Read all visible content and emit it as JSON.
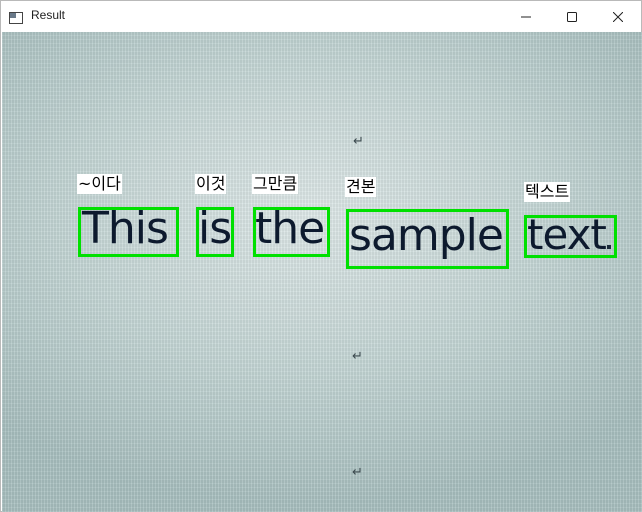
{
  "window": {
    "title": "Result",
    "icons": {
      "app": "window-app-icon",
      "minimize": "minimize-icon",
      "maximize": "maximize-icon",
      "close": "close-icon"
    }
  },
  "canvas": {
    "return_mark": "↵",
    "box_color": "#00e000",
    "words": [
      {
        "text": "This",
        "translation": "~이다"
      },
      {
        "text": "is",
        "translation": "이것"
      },
      {
        "text": "the",
        "translation": "그만큼"
      },
      {
        "text": "sample",
        "translation": "견본"
      },
      {
        "text": "text",
        "translation": "텍스트"
      }
    ]
  }
}
